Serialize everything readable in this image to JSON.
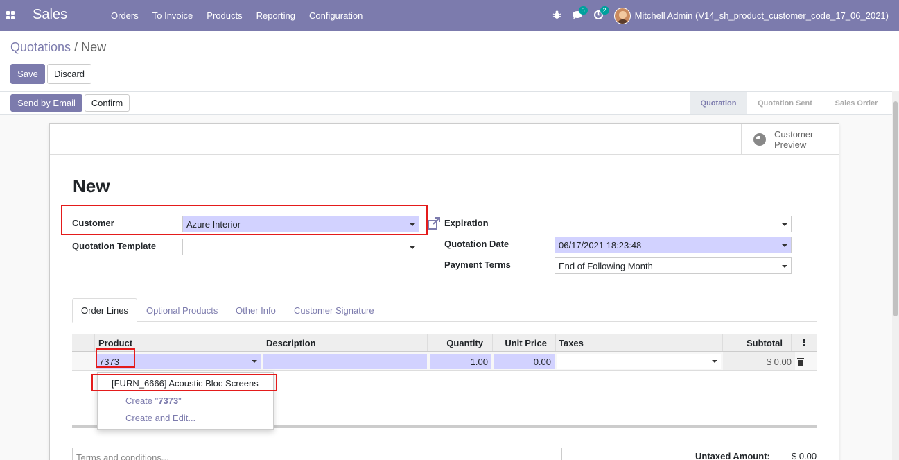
{
  "navbar": {
    "brand": "Sales",
    "menu": [
      "Orders",
      "To Invoice",
      "Products",
      "Reporting",
      "Configuration"
    ],
    "messages_count": "5",
    "activities_count": "2",
    "user": "Mitchell Admin (V14_sh_product_customer_code_17_06_2021)"
  },
  "breadcrumb": {
    "parent": "Quotations",
    "separator": "/",
    "current": "New"
  },
  "control": {
    "save": "Save",
    "discard": "Discard"
  },
  "header": {
    "send_email": "Send by Email",
    "confirm": "Confirm",
    "stages": [
      "Quotation",
      "Quotation Sent",
      "Sales Order"
    ],
    "active_stage": "Quotation"
  },
  "sheet": {
    "customer_preview_line1": "Customer",
    "customer_preview_line2": "Preview",
    "title": "New",
    "customer_label": "Customer",
    "customer_value": "Azure Interior",
    "template_label": "Quotation Template",
    "template_value": "",
    "expiration_label": "Expiration",
    "expiration_value": "",
    "quotation_date_label": "Quotation Date",
    "quotation_date_value": "06/17/2021 18:23:48",
    "payment_terms_label": "Payment Terms",
    "payment_terms_value": "End of Following Month"
  },
  "tabs": [
    "Order Lines",
    "Optional Products",
    "Other Info",
    "Customer Signature"
  ],
  "table": {
    "columns": [
      "Product",
      "Description",
      "Quantity",
      "Unit Price",
      "Taxes",
      "Subtotal"
    ],
    "row": {
      "product": "7373",
      "description": "",
      "quantity": "1.00",
      "unit_price": "0.00",
      "taxes": "",
      "subtotal": "$ 0.00"
    }
  },
  "autocomplete": {
    "suggestion": "[FURN_6666] Acoustic Bloc Screens",
    "create_prefix": "Create \"",
    "create_term": "7373",
    "create_suffix": "\"",
    "create_edit": "Create and Edit..."
  },
  "footer": {
    "terms_placeholder": "Terms and conditions...",
    "untaxed_label": "Untaxed Amount:",
    "untaxed_value": "$ 0.00"
  },
  "colors": {
    "accent": "#7c7bad",
    "required": "#d2d2ff",
    "highlight": "#e41b1b"
  }
}
